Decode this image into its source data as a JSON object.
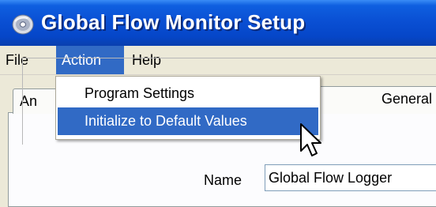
{
  "window": {
    "title": "Global Flow Monitor Setup",
    "icon": "app-disc-icon",
    "title_bar_color": "#0a50d4"
  },
  "menubar": {
    "items": [
      {
        "label": "File"
      },
      {
        "label": "Action",
        "active": true
      },
      {
        "label": "Help"
      }
    ],
    "highlight_color": "#316ac5"
  },
  "dropdown": {
    "items": [
      {
        "label": "Program Settings"
      },
      {
        "label": "Initialize to Default Values",
        "highlighted": true
      }
    ]
  },
  "tabs": [
    {
      "label": "An"
    },
    {
      "label": "General"
    }
  ],
  "form": {
    "name_label": "Name",
    "name_value": "Global Flow Logger"
  },
  "cursor": {
    "icon": "arrow-cursor-icon"
  }
}
